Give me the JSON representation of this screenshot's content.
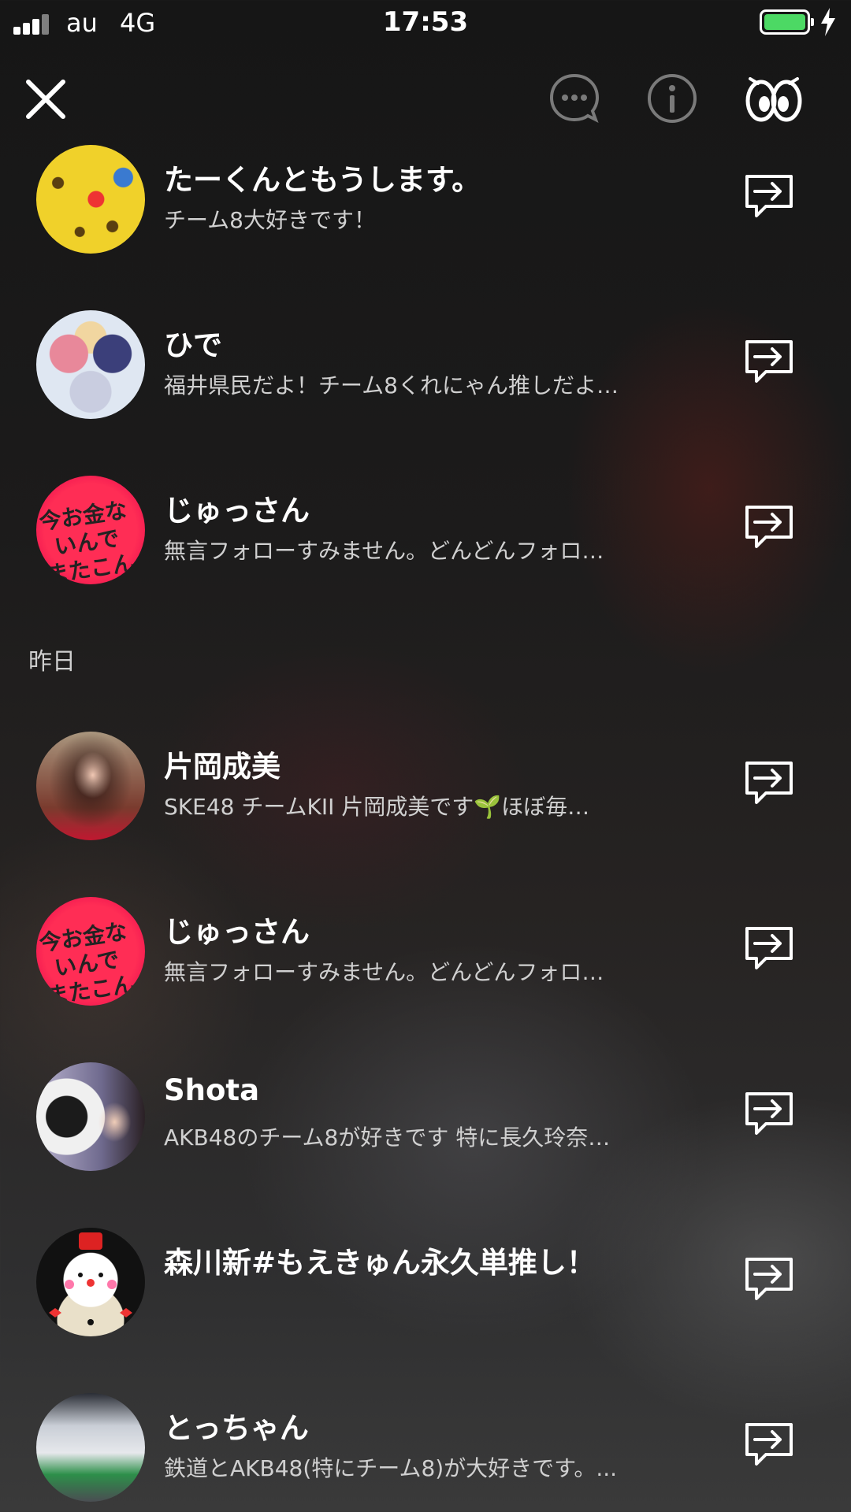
{
  "status_bar": {
    "carrier": "au",
    "network": "4G",
    "time": "17:53",
    "battery_color": "#4cd964"
  },
  "top_bar": {
    "close_icon": "close-icon",
    "chat_icon": "chat-bubble-icon",
    "info_icon": "info-icon",
    "eyes_icon": "eyes-icon"
  },
  "users_today": [
    {
      "name": "たーくんともうします。",
      "bio": "チーム8大好きです！"
    },
    {
      "name": "ひで",
      "bio": "福井県民だよ！チーム8くれにゃん推しだよ…"
    },
    {
      "name": "じゅっさん",
      "bio": "無言フォローすみません。どんどんフォロ…"
    }
  ],
  "section_yesterday": "昨日",
  "users_yesterday": [
    {
      "name": "片岡成美",
      "bio": "SKE48 チームKII 片岡成美です🌱ほぼ毎…"
    },
    {
      "name": "じゅっさん",
      "bio": "無言フォローすみません。どんどんフォロ…"
    },
    {
      "name": "Shota",
      "bio": "AKB48のチーム8が好きです 特に長久玲奈…"
    },
    {
      "name": "森川新#もえきゅん永久単推し！",
      "bio": ""
    },
    {
      "name": "とっちゃん",
      "bio": "鉄道とAKB48(特にチーム8)が大好きです。..."
    }
  ],
  "avatar_text": {
    "red_badge_line1": "今お金ないんで",
    "red_badge_line2": "またこんどにします"
  }
}
